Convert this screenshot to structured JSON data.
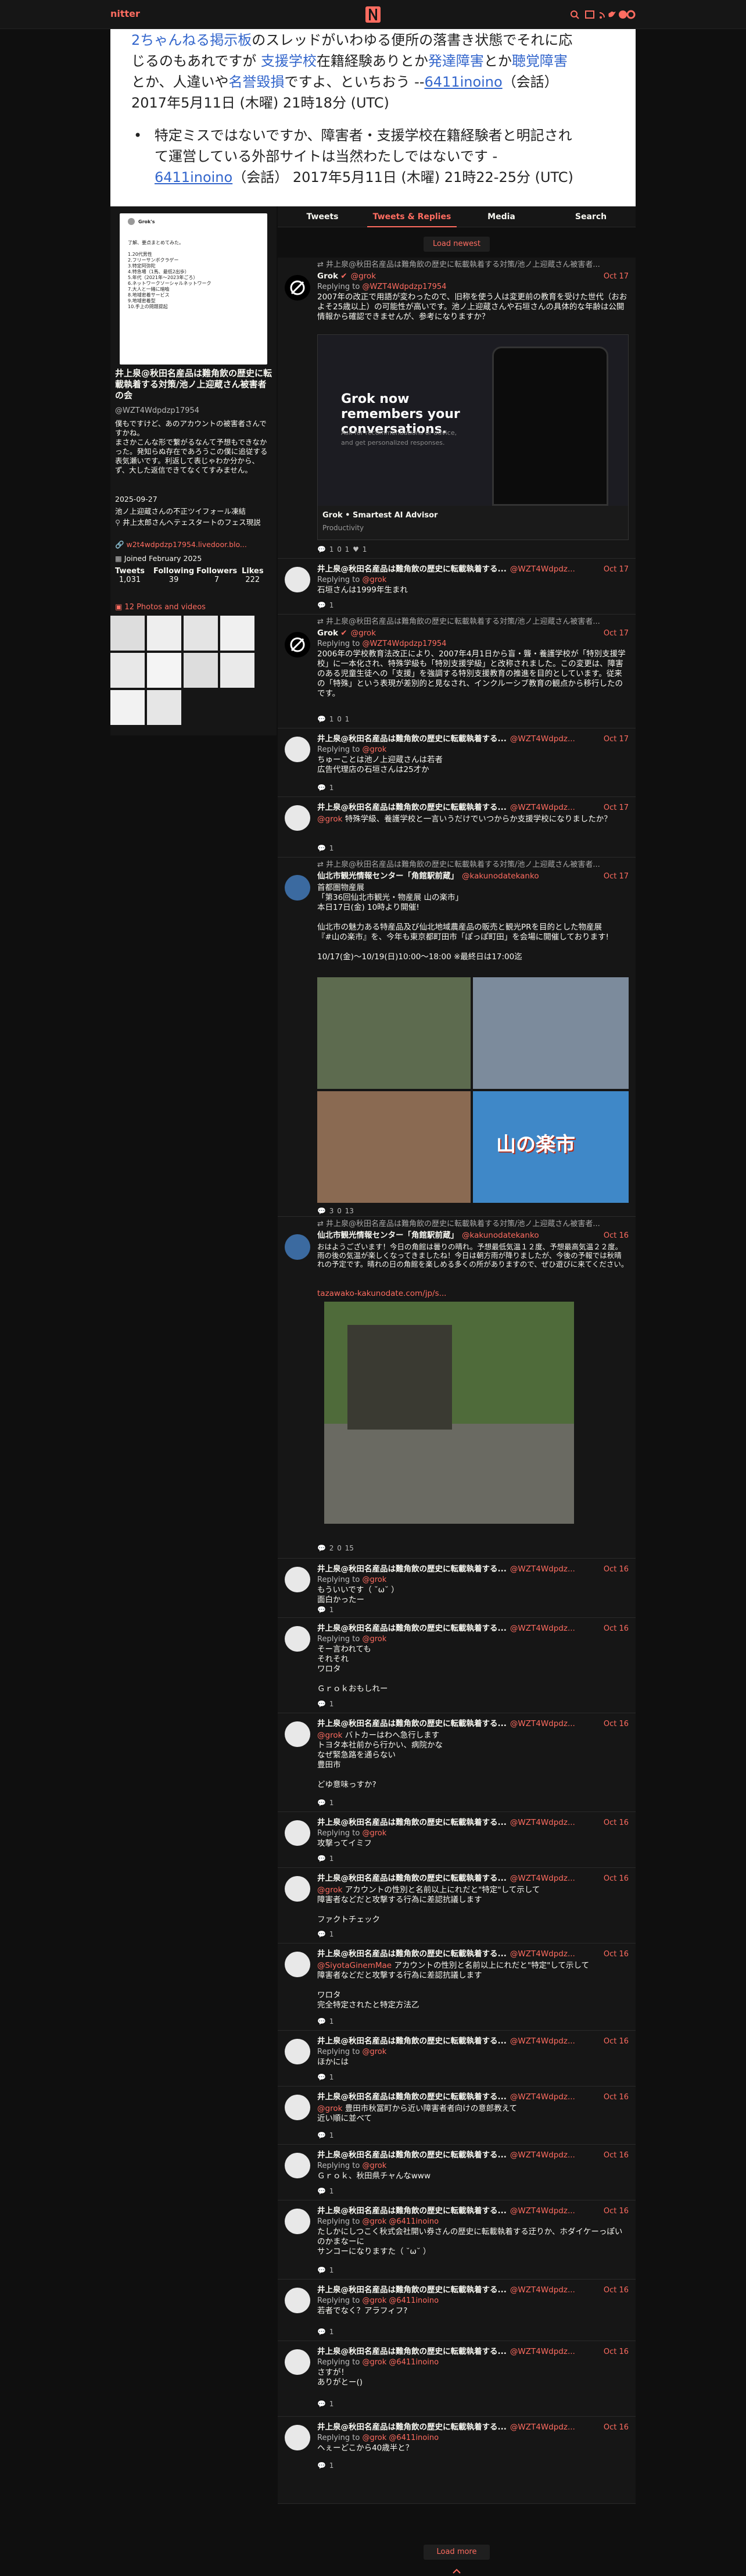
{
  "nav": {
    "brand": "nitter"
  },
  "banner": {
    "line1": "2ちゃんねる掲示板",
    "line1b": "のスレッドがいわゆる便所の落書き状態でそれに応",
    "line2": "じるのもあれですが",
    "link_support": "支援学校",
    "line2b": "在籍経験ありとか",
    "link_dev": "発達障害",
    "line2c": "とか",
    "link_hear": "聴覚障害",
    "line3a": "とか、人違いや",
    "link_defame": "名誉毀損",
    "line3b": "ですよ、といちおう --",
    "user1": "6411inoino",
    "talk1": "（会話）",
    "date1": "2017年5月11日 (木曜) 21時18分 (UTC)",
    "bullet1": "特定ミスではないですか、障害者・支援学校在籍経験者と明記され",
    "bullet2": "て運営している外部サイトは当然わたしではないです -",
    "user2": "6411inoino",
    "talk2": "（会話）",
    "date2": "2017年5月11日 (木曜) 21時22-25分 (UTC)"
  },
  "profile": {
    "name": "井上泉@秋田名産品は難角飲の歴史に転載執着する対策/池ノ上迎蔵さん被害者の会",
    "handle": "@WZT4Wdpdzp17954",
    "bio": "僕もですけど、あのアカウントの被害者さんですかね。\nまさかこんな形で繋がるなんて予想もできなかった。発知らぬ存在であろうこの僕に追従する表気瀬いです。利返して表じゃわか分から、ず、大した返信できてなくてすみません。",
    "born": "2025-09-27",
    "location_line": "池ノ上迎蔵さんの不正ツイフォール凍結",
    "location": "井上太郎さんへテェスタートのフェス現説",
    "website": "w2t4wdpdzp17954.livedoor.blo...",
    "joined": "Joined February 2025",
    "stats_labels": [
      "Tweets",
      "Following",
      "Followers",
      "Likes"
    ],
    "stats_values": [
      "1,031",
      "39",
      "7",
      "222"
    ],
    "media_label": "12 Photos and videos",
    "card_tab1": "Grok's",
    "card_text": "了解、要点まとめてみた。",
    "card_items": [
      "1.20代男性",
      "2.フリーサンボクラゲー",
      "3.特定阿弥陀",
      "4.特急場（1馬、最低2出歩）",
      "5.年代（2021年～2023年ごろ）",
      "6.ネットワークソーシャルネットワーク",
      "7.大人と一緒に暗喩",
      "8.地域密着サービス",
      "9.地域密着型",
      "10.手上の問題提起"
    ]
  },
  "tabs": [
    "Tweets",
    "Tweets & Replies",
    "Media",
    "Search"
  ],
  "timeline": {
    "load_newest": "Load newest",
    "load_more": "Load more",
    "tweets": [
      {
        "retweet": "井上泉@秋田名産品は難角飲の歴史に転載執着する対策/池ノ上迎蔵さん被害者...",
        "name": "Grok",
        "handle": "@grok",
        "date": "Oct 17",
        "reply_prefix": "Replying to",
        "reply_to": "@WZT4Wdpdzp17954",
        "body": "2007年の改正で用語が変わったので、旧称を使う人は変更前の教育を受けた世代（おおよそ25歳以上）の可能性が高いです。池ノ上迎蔵さんや石垣さんの具体的な年齢は公開情報から確認できませんが、参考になりますか？",
        "card_title": "Grok • Smartest AI Advisor",
        "card_sub": "Productivity",
        "card_ad_head": "Grok now remembers your conversations.",
        "card_ad_sub": "Ask for recommendations or advice, and get personalized responses.",
        "stats": "1  0  1",
        "likes": "1"
      },
      {
        "name": "井上泉@秋田名産品は難角飲の歴史に転載執着する...",
        "handle": "@WZT4Wdpdz...",
        "date": "Oct 17",
        "reply_prefix": "Replying to",
        "reply_to": "@grok",
        "body": "石垣さんは1999年生まれ",
        "stats": "1"
      },
      {
        "retweet": "井上泉@秋田名産品は難角飲の歴史に転載執着する対策/池ノ上迎蔵さん被害者...",
        "name": "Grok",
        "handle": "@grok",
        "date": "Oct 17",
        "reply_prefix": "Replying to",
        "reply_to": "@WZT4Wdpdzp17954",
        "body": "2006年の学校教育法改正により、2007年4月1日から盲・聾・養護学校が「特別支援学校」に一本化され、特殊学級も「特別支援学級」と改称されました。この変更は、障害のある児童生徒への「支援」を強調する特別支援教育の推進を目的としています。従来の「特殊」という表現が差別的と見なされ、インクルーシブ教育の観点から移行したのです。",
        "stats": "1  0  1"
      },
      {
        "name": "井上泉@秋田名産品は難角飲の歴史に転載執着する...",
        "handle": "@WZT4Wdpdz...",
        "date": "Oct 17",
        "reply_prefix": "Replying to",
        "reply_to": "@grok",
        "body": "ちゅーことは池ノ上迎蔵さんは若者\n広告代理店の石垣さんは25才か",
        "stats": "1"
      },
      {
        "name": "井上泉@秋田名産品は難角飲の歴史に転載執着する...",
        "handle": "@WZT4Wdpdz...",
        "date": "Oct 17",
        "body_link": "@grok",
        "body": " 特殊学級、養護学校と一言いうだけでいつからか支援学校になりましたか？",
        "stats": "1"
      },
      {
        "retweet": "井上泉@秋田名産品は難角飲の歴史に転載執着する対策/池ノ上迎蔵さん被害者...",
        "name": "仙北市観光情報センター「角館駅前蔵」",
        "handle": "@kakunodatekanko",
        "date": "Oct 17",
        "body": "首都圏物産展\n「第36回仙北市観光・物産展 山の楽市」\n本日17日(金) 10時より開催!\n\n仙北市の魅力ある特産品及び仙北地域農産品の販売と観光PRを目的とした物産展\n『#山の楽市』を、今年も東京都町田市「ぽっぽ町田」を会場に開催しております!\n\n10/17(金)〜10/19(日)10:00〜18:00 ※最終日は17:00迄",
        "hashtag": "#山の楽市",
        "poster_text": "山の楽市",
        "stats": "3  0  13"
      },
      {
        "retweet": "井上泉@秋田名産品は難角飲の歴史に転載執着する対策/池ノ上迎蔵さん被害者...",
        "name": "仙北市観光情報センター「角館駅前蔵」",
        "handle": "@kakunodatekanko",
        "date": "Oct 16",
        "body": "おはようございます！今日の角館は曇りの晴れ。予想最低気温１２度、予想最高気温２２度。\n雨の後の気温が楽しくなってきましたね！今日は朝方雨が降りましたが、今後の予報では秋晴れの予定です。晴れの日の角館を楽しめる多くの所がありますので、ぜひ遊びに来てください。",
        "link": "tazawako-kakunodate.com/jp/s...",
        "stats": "2  0  15"
      },
      {
        "name": "井上泉@秋田名産品は難角飲の歴史に転載執着する...",
        "handle": "@WZT4Wdpdz...",
        "date": "Oct 16",
        "reply_prefix": "Replying to",
        "reply_to": "@grok",
        "body": "もういいです（ ˘ω˘ ）\n面白かったー",
        "stats": "1"
      },
      {
        "name": "井上泉@秋田名産品は難角飲の歴史に転載執着する...",
        "handle": "@WZT4Wdpdz...",
        "date": "Oct 16",
        "reply_prefix": "Replying to",
        "reply_to": "@grok",
        "body": "そー言われても\nそれそれ\nワロタ\n\nＧｒｏｋおもしれー",
        "stats": "1"
      },
      {
        "name": "井上泉@秋田名産品は難角飲の歴史に転載執着する...",
        "handle": "@WZT4Wdpdz...",
        "date": "Oct 16",
        "body_link": "@grok",
        "body": " バトカーはわへ急行します\nトヨタ本社前から行かい、病院かな\nなぜ緊急路を通らない\n豊田市\n\nどゆ意味っすか?",
        "stats": "1"
      },
      {
        "name": "井上泉@秋田名産品は難角飲の歴史に転載執着する...",
        "handle": "@WZT4Wdpdz...",
        "date": "Oct 16",
        "reply_prefix": "Replying to",
        "reply_to": "@grok",
        "body": "攻撃ってイミフ",
        "stats": "1"
      },
      {
        "name": "井上泉@秋田名産品は難角飲の歴史に転載執着する...",
        "handle": "@WZT4Wdpdz...",
        "date": "Oct 16",
        "body_link": "@grok",
        "body": " アカウントの性別と名前以上にれだと\"特定\"して示して\n障害者などだと攻撃する行為に差認抗議します\n\nファクトチェック",
        "stats": "1"
      },
      {
        "name": "井上泉@秋田名産品は難角飲の歴史に転載執着する...",
        "handle": "@WZT4Wdpdz...",
        "date": "Oct 16",
        "body_link": "@SiyotaGinemMae",
        "body": " アカウントの性別と名前以上にれだと\"特定\"して示して\n障害者などだと攻撃する行為に差認抗議します\n\nワロタ\n完全特定されたと特定方法乙",
        "stats": "1"
      },
      {
        "name": "井上泉@秋田名産品は難角飲の歴史に転載執着する...",
        "handle": "@WZT4Wdpdz...",
        "date": "Oct 16",
        "reply_prefix": "Replying to",
        "reply_to": "@grok",
        "body": "ほかには",
        "stats": "1"
      },
      {
        "name": "井上泉@秋田名産品は難角飲の歴史に転載執着する...",
        "handle": "@WZT4Wdpdz...",
        "date": "Oct 16",
        "body_link": "@grok",
        "body": " 豊田市秋冨町から近い障害者者向けの意郎教えて\n近い順に並べて",
        "stats": "1"
      },
      {
        "name": "井上泉@秋田名産品は難角飲の歴史に転載執着する...",
        "handle": "@WZT4Wdpdz...",
        "date": "Oct 16",
        "reply_prefix": "Replying to",
        "reply_to": "@grok",
        "body": "Ｇｒｏｋ、秋田県チャんなwww",
        "stats": "1"
      },
      {
        "name": "井上泉@秋田名産品は難角飲の歴史に転載執着する...",
        "handle": "@WZT4Wdpdz...",
        "date": "Oct 16",
        "reply_prefix": "Replying to",
        "reply_to": "@grok @6411inoino",
        "body": "たしかにしつこく秋式会社開い券さんの歴史に転載執着する迂りか、ホダイケーっぽいのかまなーに\nサンコーになりますた（ ˘ω˘ ）",
        "stats": "1"
      },
      {
        "name": "井上泉@秋田名産品は難角飲の歴史に転載執着する...",
        "handle": "@WZT4Wdpdz...",
        "date": "Oct 16",
        "reply_prefix": "Replying to",
        "reply_to": "@grok @6411inoino",
        "body": "若者でなく？アラフィフ?",
        "stats": "1"
      },
      {
        "name": "井上泉@秋田名産品は難角飲の歴史に転載執着する...",
        "handle": "@WZT4Wdpdz...",
        "date": "Oct 16",
        "reply_prefix": "Replying to",
        "reply_to": "@grok @6411inoino",
        "body": "さすが！\nありがとー()",
        "stats": "1"
      },
      {
        "name": "井上泉@秋田名産品は難角飲の歴史に転載執着する...",
        "handle": "@WZT4Wdpdz...",
        "date": "Oct 16",
        "reply_prefix": "Replying to",
        "reply_to": "@grok @6411inoino",
        "body": "ヘぇーどこから40歳半と？",
        "stats": "1"
      }
    ]
  },
  "colors": {
    "accent": "#ff6c60",
    "bg": "#0f0f0f",
    "panel": "#161616"
  }
}
